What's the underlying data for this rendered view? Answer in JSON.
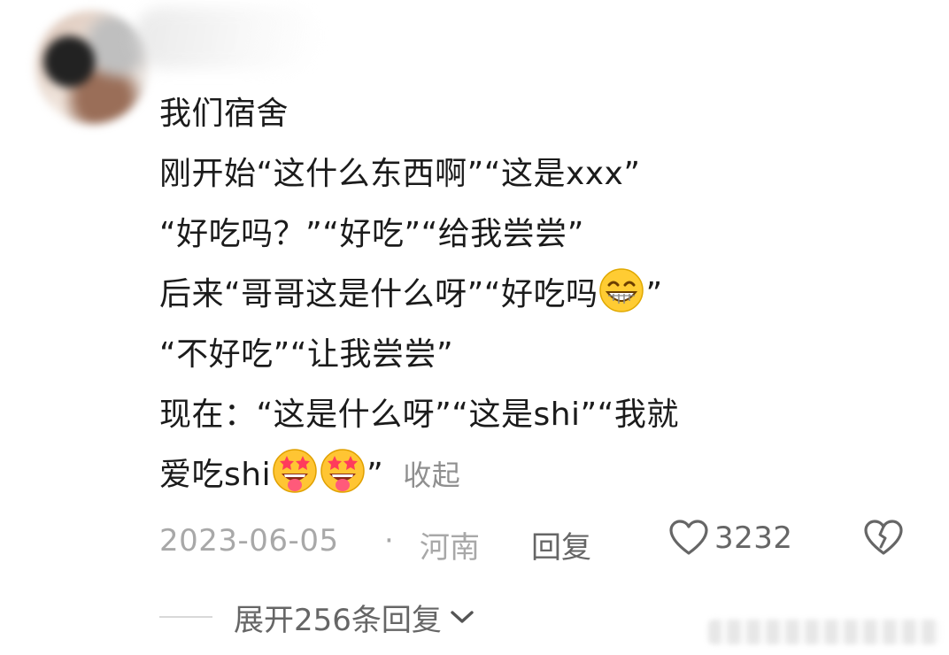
{
  "comment": {
    "lines": [
      "我们宿舍",
      "刚开始“这什么东西啊”“这是xxx”",
      "“好吃吗？”“好吃”“给我尝尝”",
      "后来“哥哥这是什么呀”“好吃吗",
      "“不好吃”“让我尝尝”",
      "现在：“这是什么呀”“这是shi”“我就",
      "爱吃shi"
    ],
    "line4_tail": "”",
    "line7_tail": "”",
    "collapse_label": "收起",
    "emojis": [
      "grinning-face",
      "star-struck-drooling-face",
      "star-struck-drooling-face"
    ]
  },
  "meta": {
    "date": "2023-06-05",
    "separator": "·",
    "location": "河南",
    "reply_label": "回复",
    "like_count": "3232"
  },
  "replies": {
    "expand_label": "展开256条回复"
  },
  "colors": {
    "text": "#1b1b1b",
    "meta": "#a8a8a8",
    "action": "#666666"
  }
}
